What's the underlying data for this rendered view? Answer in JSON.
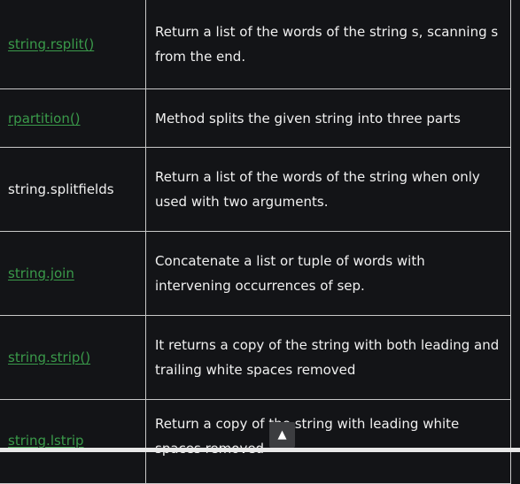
{
  "rows": [
    {
      "name": "string.rsplit()",
      "link": true,
      "desc": "Return a list of the words of the string s, scanning s from the end."
    },
    {
      "name": "rpartition()",
      "link": true,
      "desc": "Method splits the given string into three parts"
    },
    {
      "name": "string.splitfields",
      "link": false,
      "desc": "Return a list of the words of the string when only used with two arguments."
    },
    {
      "name": "string.join",
      "link": true,
      "desc": "Concatenate a list or tuple of words with intervening occurrences of sep."
    },
    {
      "name": "string.strip()",
      "link": true,
      "desc": "It returns a copy of the string with both leading and trailing white spaces removed"
    },
    {
      "name": "string.lstrip",
      "link": true,
      "desc": "Return a copy of the string with leading white spaces removed"
    }
  ],
  "scroll_top_icon": "arrow-up-icon"
}
